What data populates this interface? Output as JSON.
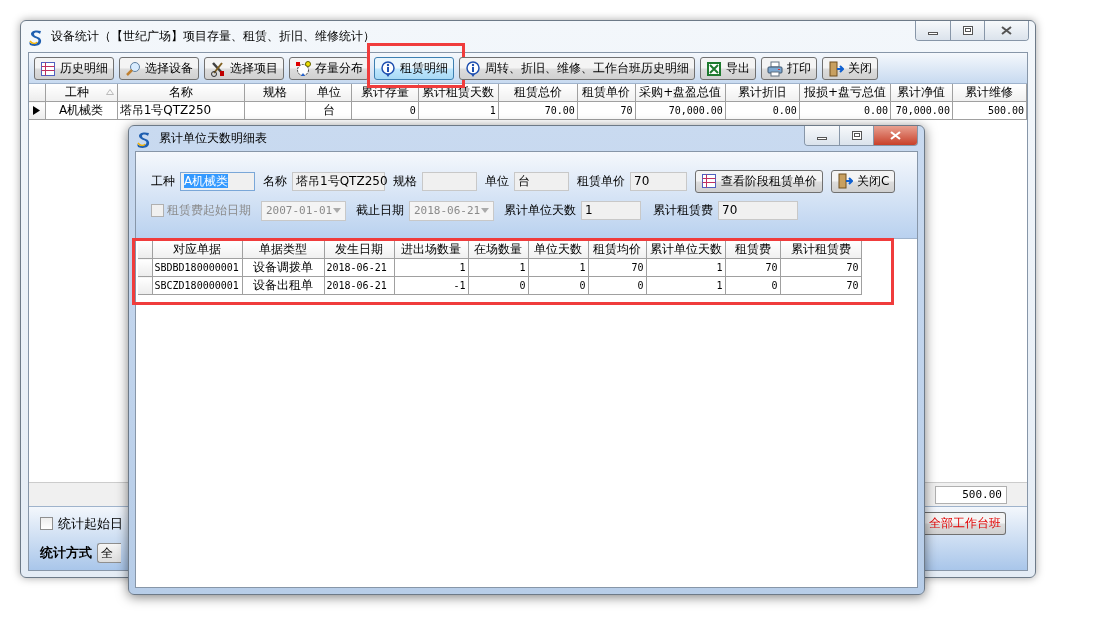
{
  "main_window": {
    "title": "设备统计（【世纪广场】项目存量、租赁、折旧、维修统计）",
    "toolbar": [
      {
        "label": "历史明细",
        "highlighted": false
      },
      {
        "label": "选择设备",
        "highlighted": false
      },
      {
        "label": "选择项目",
        "highlighted": false
      },
      {
        "label": "存量分布",
        "highlighted": false
      },
      {
        "label": "租赁明细",
        "highlighted": true
      },
      {
        "label": "周转、折旧、维修、工作台班历史明细",
        "highlighted": false
      },
      {
        "label": "导出",
        "highlighted": false
      },
      {
        "label": "打印",
        "highlighted": false
      },
      {
        "label": "关闭",
        "highlighted": false
      }
    ],
    "grid": {
      "columns": [
        "工种",
        "名称",
        "规格",
        "单位",
        "累计存量",
        "累计租赁天数",
        "租赁总价",
        "租赁单价",
        "采购+盘盈总值",
        "累计折旧",
        "报损+盘亏总值",
        "累计净值",
        "累计维修"
      ],
      "rows": [
        {
          "selected": true,
          "cells": [
            "A机械类",
            "塔吊1号QTZ250",
            "",
            "台",
            "0",
            "1",
            "70.00",
            "70",
            "70,000.00",
            "0.00",
            "0.00",
            "70,000.00",
            "500.00"
          ]
        }
      ],
      "summary": [
        "500.00"
      ]
    },
    "bottom": {
      "start_date": {
        "label": "统计起始日",
        "checked": false
      },
      "method_label": "统计方式",
      "method_value": "全",
      "red_button": "全部工作台班"
    }
  },
  "dialog": {
    "title": "累计单位天数明细表",
    "fields": [
      {
        "label": "工种",
        "value": "A机械类",
        "text_selected": true
      },
      {
        "label": "名称",
        "value": "塔吊1号QTZ250",
        "text_selected": false
      },
      {
        "label": "规格",
        "text_selected": false
      },
      {
        "label": "单位",
        "value": "台",
        "text_selected": false
      },
      {
        "label": "租赁单价",
        "value": "70",
        "text_selected": false
      }
    ],
    "buttons": [
      "查看阶段租赁单价",
      "关闭C"
    ],
    "filters": [
      {
        "kind": "checkbox",
        "label": "租赁费起始日期",
        "checked": false,
        "disabled": true
      },
      {
        "kind": "dropdown",
        "value": "2007-01-01",
        "disabled": true
      },
      {
        "kind": "label",
        "text": "截止日期"
      },
      {
        "kind": "dropdown",
        "value": "2018-06-21",
        "disabled": true
      },
      {
        "kind": "field",
        "label": "累计单位天数",
        "value": "1"
      },
      {
        "kind": "field",
        "label": "累计租赁费",
        "value": "70"
      }
    ],
    "grid": {
      "highlighted": true,
      "columns": [
        "对应单据",
        "单据类型",
        "发生日期",
        "进出场数量",
        "在场数量",
        "单位天数",
        "租赁均价",
        "累计单位天数",
        "租赁费",
        "累计租赁费"
      ],
      "rows": [
        {
          "selected": false,
          "cells": [
            "SBDBD180000001",
            "设备调拨单",
            "2018-06-21",
            "1",
            "1",
            "1",
            "70",
            "1",
            "70",
            "70"
          ]
        },
        {
          "selected": false,
          "cells": [
            "SBCZD180000001",
            "设备出租单",
            "2018-06-21",
            "-1",
            "0",
            "0",
            "0",
            "1",
            "0",
            "70"
          ]
        }
      ]
    }
  }
}
